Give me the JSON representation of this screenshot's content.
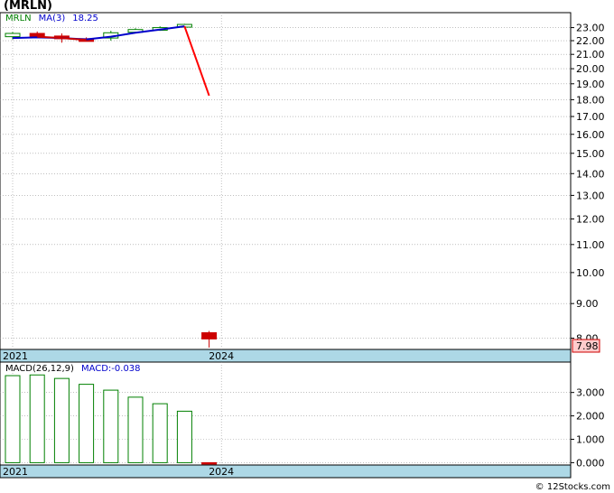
{
  "header": {
    "symbol": "(MRLN)",
    "legend_symbol": "MRLN",
    "ma_label": "MA(3)",
    "ma_value": "18.25"
  },
  "macd_legend": {
    "label": "MACD(26,12,9)",
    "value_label": "MACD:-0.038"
  },
  "watermark": "© 12Stocks.com",
  "colors": {
    "up": "#008000",
    "down": "#cc0000",
    "ma_line": "#0000cc",
    "axis_band": "#add8e6",
    "grid": "#999999",
    "last_price_box": "#ffcccc"
  },
  "chart_data": [
    {
      "type": "candlestick",
      "title": "(MRLN)",
      "y_scale": "log",
      "ylim": [
        7.7,
        24.2
      ],
      "y_ticks": [
        "23.00",
        "22.00",
        "21.00",
        "20.00",
        "19.00",
        "18.00",
        "17.00",
        "16.00",
        "15.00",
        "14.00",
        "13.00",
        "12.00",
        "11.00",
        "10.00",
        "9.00",
        "8.00"
      ],
      "x_labels": [
        {
          "label": "2021",
          "bar": 0
        },
        {
          "label": "2024",
          "bar": 8.5
        }
      ],
      "last_price": "7.98",
      "candles": [
        {
          "open": 22.3,
          "high": 22.65,
          "low": 22.1,
          "close": 22.55,
          "dir": "up"
        },
        {
          "open": 22.55,
          "high": 22.7,
          "low": 22.2,
          "close": 22.3,
          "dir": "down"
        },
        {
          "open": 22.35,
          "high": 22.55,
          "low": 21.85,
          "close": 22.2,
          "dir": "down"
        },
        {
          "open": 22.15,
          "high": 22.25,
          "low": 21.95,
          "close": 22.05,
          "dir": "down"
        },
        {
          "open": 22.2,
          "high": 22.75,
          "low": 22.0,
          "close": 22.6,
          "dir": "up"
        },
        {
          "open": 22.75,
          "high": 22.95,
          "low": 22.6,
          "close": 22.85,
          "dir": "up"
        },
        {
          "open": 22.9,
          "high": 23.1,
          "low": 22.75,
          "close": 23.0,
          "dir": "up"
        },
        {
          "open": 23.1,
          "high": 23.3,
          "low": 22.95,
          "close": 23.25,
          "dir": "up"
        },
        {
          "open": 8.15,
          "high": 8.2,
          "low": 7.75,
          "close": 7.98,
          "dir": "down"
        }
      ],
      "ma_series": [
        {
          "name": "MA(3)",
          "bars": [
            0,
            1,
            2,
            3,
            4,
            5,
            6,
            7
          ],
          "values": [
            22.2,
            22.25,
            22.2,
            22.1,
            22.3,
            22.6,
            22.85,
            23.1
          ],
          "color": "#0000cc"
        },
        {
          "bars": [
            1,
            2,
            3
          ],
          "values": [
            22.3,
            22.2,
            22.05
          ],
          "color": "#cc0000"
        },
        {
          "bars": [
            7,
            8
          ],
          "values": [
            23.1,
            18.25
          ],
          "color": "#ff0000"
        }
      ]
    },
    {
      "type": "bar",
      "title": "MACD(26,12,9)",
      "ylim": [
        -0.1,
        4.3
      ],
      "y_ticks": [
        "3.000",
        "2.000",
        "1.000",
        "0.000"
      ],
      "x_labels": [
        {
          "label": "2021",
          "bar": 0
        },
        {
          "label": "2024",
          "bar": 8.5
        }
      ],
      "values": [
        3.72,
        3.75,
        3.6,
        3.35,
        3.1,
        2.8,
        2.52,
        2.2,
        -0.038
      ]
    }
  ]
}
